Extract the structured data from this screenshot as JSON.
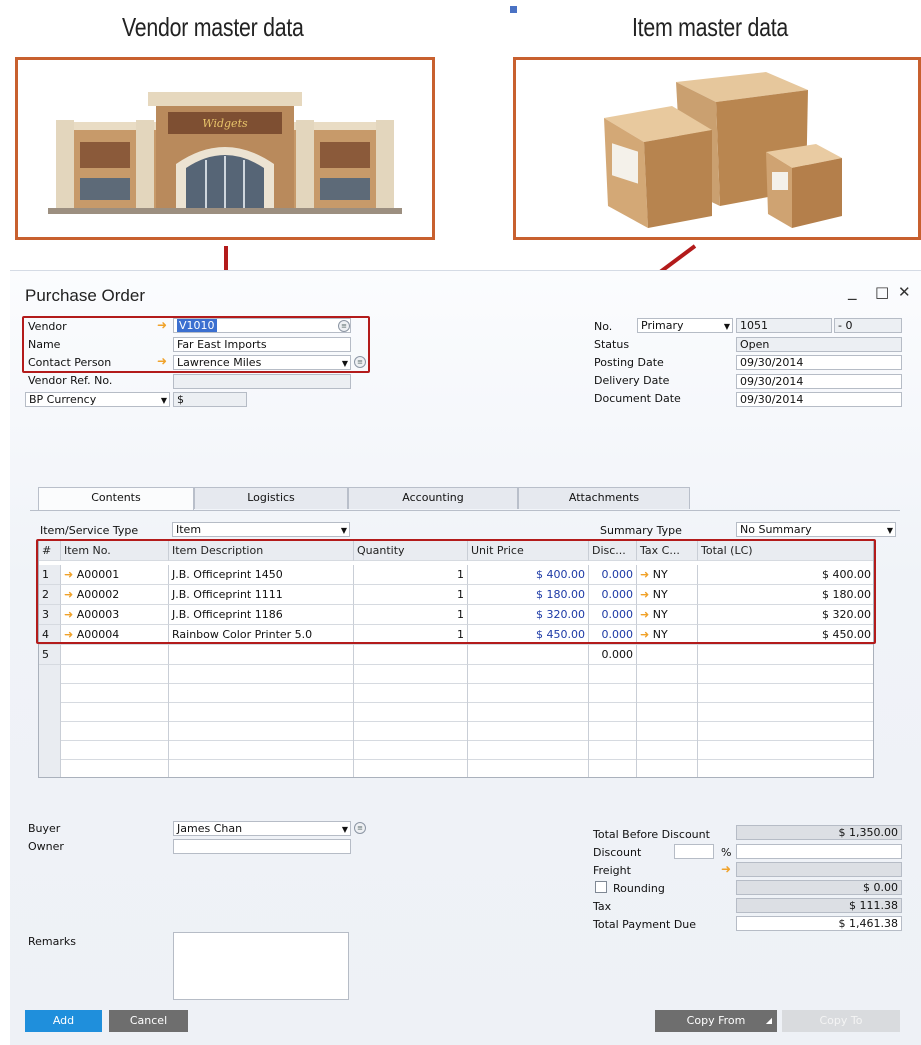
{
  "illustration": {
    "vendor_title": "Vendor master data",
    "item_title": "Item master data",
    "store_sign": "Widgets"
  },
  "window": {
    "title": "Purchase Order",
    "controls": {
      "minimize": "_",
      "maximize": "□",
      "close": "✕"
    }
  },
  "header_left": {
    "vendor_label": "Vendor",
    "vendor_value": "V1010",
    "name_label": "Name",
    "name_value": "Far East Imports",
    "contact_label": "Contact Person",
    "contact_value": "Lawrence Miles",
    "vendor_ref_label": "Vendor Ref. No.",
    "vendor_ref_value": "",
    "currency_label": "BP Currency",
    "currency_value": "$"
  },
  "header_right": {
    "no_label": "No.",
    "series_value": "Primary",
    "number_value": "1051",
    "suffix_value": "- 0",
    "status_label": "Status",
    "status_value": "Open",
    "posting_label": "Posting Date",
    "posting_value": "09/30/2014",
    "delivery_label": "Delivery Date",
    "delivery_value": "09/30/2014",
    "document_label": "Document Date",
    "document_value": "09/30/2014"
  },
  "tabs": [
    {
      "label": "Contents",
      "active": true
    },
    {
      "label": "Logistics",
      "active": false
    },
    {
      "label": "Accounting",
      "active": false
    },
    {
      "label": "Attachments",
      "active": false
    }
  ],
  "contents": {
    "type_label": "Item/Service Type",
    "type_value": "Item",
    "summary_label": "Summary Type",
    "summary_value": "No Summary"
  },
  "table": {
    "columns": [
      "#",
      "Item No.",
      "Item Description",
      "Quantity",
      "Unit Price",
      "Disc...",
      "Tax C...",
      "Total (LC)"
    ],
    "rows": [
      {
        "num": "1",
        "item": "A00001",
        "desc": "J.B. Officeprint 1450",
        "qty": "1",
        "price": "$ 400.00",
        "disc": "0.000",
        "tax": "NY",
        "total": "$ 400.00"
      },
      {
        "num": "2",
        "item": "A00002",
        "desc": "J.B. Officeprint 1111",
        "qty": "1",
        "price": "$ 180.00",
        "disc": "0.000",
        "tax": "NY",
        "total": "$ 180.00"
      },
      {
        "num": "3",
        "item": "A00003",
        "desc": "J.B. Officeprint 1186",
        "qty": "1",
        "price": "$ 320.00",
        "disc": "0.000",
        "tax": "NY",
        "total": "$ 320.00"
      },
      {
        "num": "4",
        "item": "A00004",
        "desc": "Rainbow Color Printer 5.0",
        "qty": "1",
        "price": "$ 450.00",
        "disc": "0.000",
        "tax": "NY",
        "total": "$ 450.00"
      }
    ],
    "new_row": {
      "num": "5",
      "disc": "0.000"
    }
  },
  "footer_left": {
    "buyer_label": "Buyer",
    "buyer_value": "James Chan",
    "owner_label": "Owner",
    "owner_value": "",
    "remarks_label": "Remarks",
    "remarks_value": ""
  },
  "totals": {
    "before_discount_label": "Total Before Discount",
    "before_discount_value": "$ 1,350.00",
    "discount_label": "Discount",
    "discount_pct": "",
    "percent_sign": "%",
    "freight_label": "Freight",
    "rounding_label": "Rounding",
    "rounding_value": "$ 0.00",
    "tax_label": "Tax",
    "tax_value": "$ 111.38",
    "total_due_label": "Total Payment Due",
    "total_due_value": "$ 1,461.38"
  },
  "buttons": {
    "add": "Add",
    "cancel": "Cancel",
    "copy_from": "Copy From",
    "copy_to": "Copy To"
  },
  "colors": {
    "frame_orange": "#c8602f",
    "callout_red": "#b31b1b",
    "add_button": "#1f8fdc",
    "dark_button": "#6e6e6e"
  }
}
